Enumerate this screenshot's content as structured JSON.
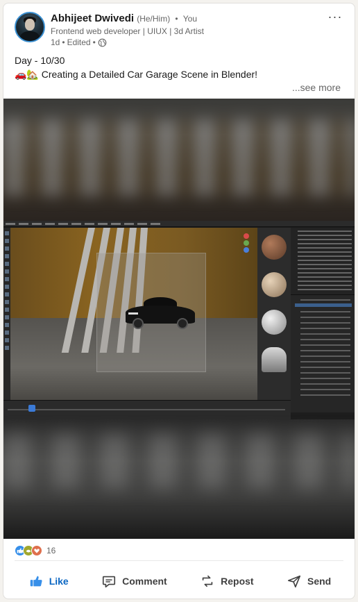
{
  "author": {
    "name": "Abhijeet Dwivedi",
    "pronouns": "(He/Him)",
    "relation": "You",
    "headline": "Frontend web developer | UIUX | 3d Artist",
    "time": "1d",
    "edited": "Edited",
    "visibility_icon": "globe-icon"
  },
  "post": {
    "line1": "Day - 10/30",
    "line2": "🚗🏡 Creating a Detailed Car Garage Scene in Blender!",
    "see_more": "...see more"
  },
  "media": {
    "alt": "Blender viewport screenshot of a car garage scene"
  },
  "social": {
    "reaction_icons": [
      "like-icon",
      "support-icon",
      "love-icon"
    ],
    "reaction_count": "16"
  },
  "actions": {
    "like": "Like",
    "comment": "Comment",
    "repost": "Repost",
    "send": "Send"
  },
  "colors": {
    "brand_blue": "#0a66c2",
    "text_secondary": "#666666"
  }
}
